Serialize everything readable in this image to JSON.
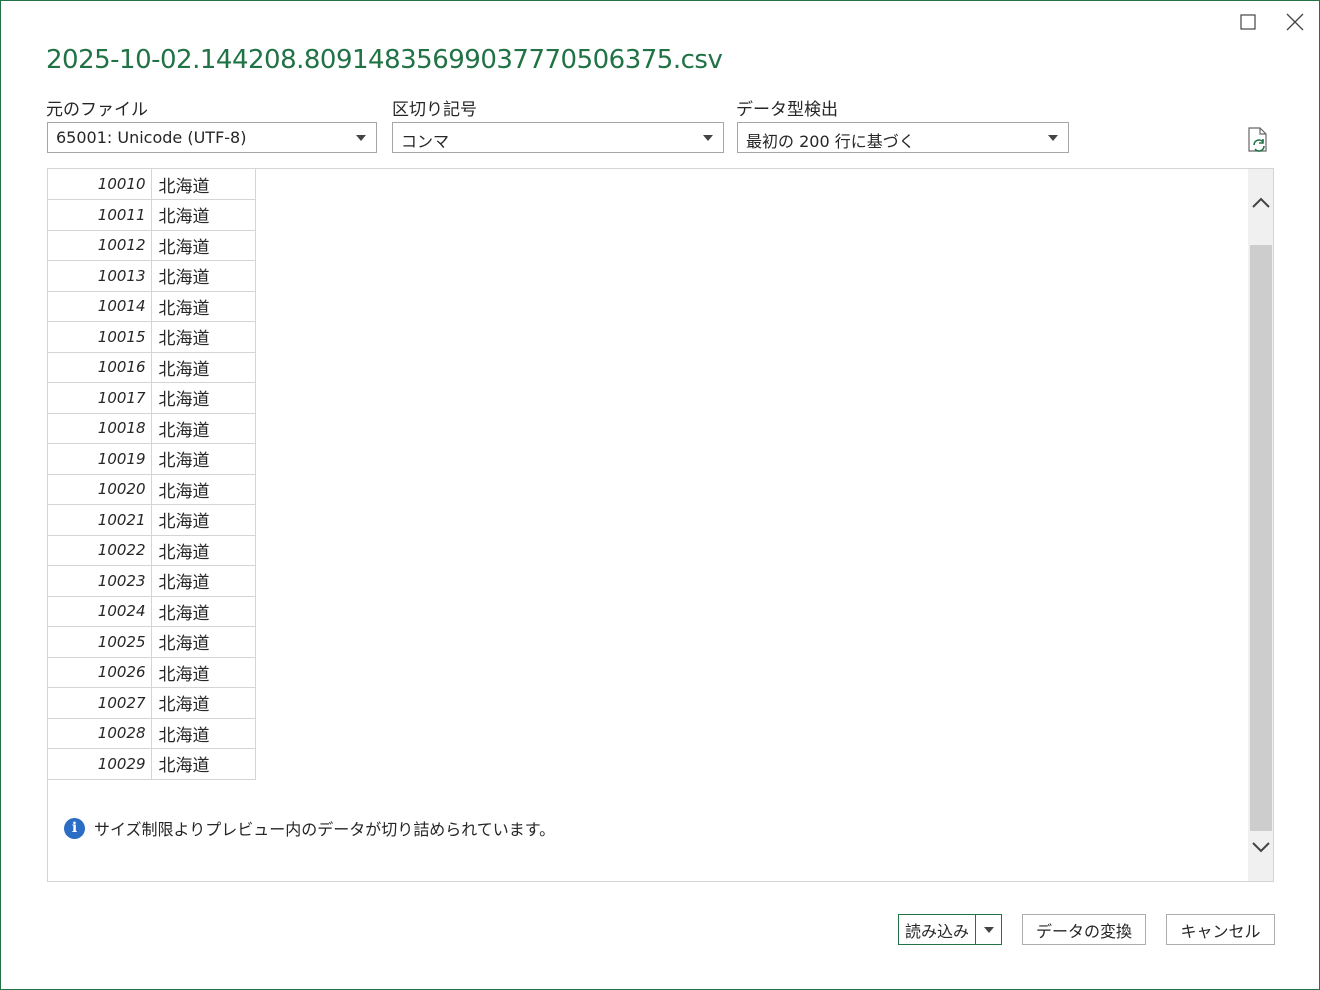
{
  "window": {
    "title": "2025-10-02.144208.80914835699037770506375.csv",
    "accent_color": "#217346",
    "controls": [
      "maximize-icon",
      "close-icon"
    ]
  },
  "options": {
    "file_origin": {
      "label": "元のファイル",
      "value": "65001: Unicode (UTF-8)"
    },
    "delimiter": {
      "label": "区切り記号",
      "value": "コンマ"
    },
    "type_detection": {
      "label": "データ型検出",
      "value": "最初の 200 行に基づく"
    },
    "refresh_icon": "refresh-icon"
  },
  "preview": {
    "rows": [
      {
        "code": "10010",
        "pref": "北海道"
      },
      {
        "code": "10011",
        "pref": "北海道"
      },
      {
        "code": "10012",
        "pref": "北海道"
      },
      {
        "code": "10013",
        "pref": "北海道"
      },
      {
        "code": "10014",
        "pref": "北海道"
      },
      {
        "code": "10015",
        "pref": "北海道"
      },
      {
        "code": "10016",
        "pref": "北海道"
      },
      {
        "code": "10017",
        "pref": "北海道"
      },
      {
        "code": "10018",
        "pref": "北海道"
      },
      {
        "code": "10019",
        "pref": "北海道"
      },
      {
        "code": "10020",
        "pref": "北海道"
      },
      {
        "code": "10021",
        "pref": "北海道"
      },
      {
        "code": "10022",
        "pref": "北海道"
      },
      {
        "code": "10023",
        "pref": "北海道"
      },
      {
        "code": "10024",
        "pref": "北海道"
      },
      {
        "code": "10025",
        "pref": "北海道"
      },
      {
        "code": "10026",
        "pref": "北海道"
      },
      {
        "code": "10027",
        "pref": "北海道"
      },
      {
        "code": "10028",
        "pref": "北海道"
      },
      {
        "code": "10029",
        "pref": "北海道"
      }
    ],
    "info_message": "サイズ制限よりプレビュー内のデータが切り詰められています。"
  },
  "buttons": {
    "load": "読み込み",
    "transform": "データの変換",
    "cancel": "キャンセル"
  }
}
